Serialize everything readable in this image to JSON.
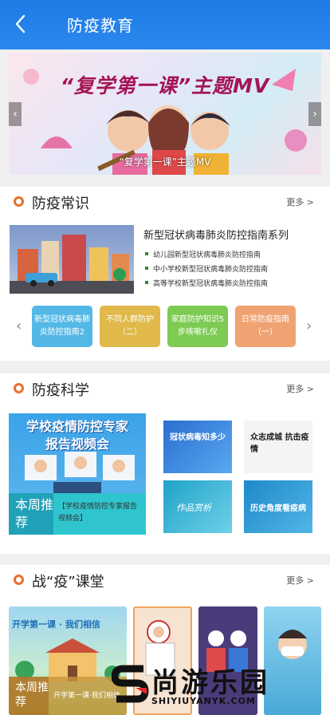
{
  "header": {
    "title": "防疫教育"
  },
  "banner": {
    "title": "“复学第一课”主题MV",
    "caption": "“复学第一课”主题MV"
  },
  "knowledge": {
    "title": "防疫常识",
    "more": "更多 >",
    "topic": "新型冠状病毒肺炎防控指南系列",
    "items": [
      "幼儿园新型冠状病毒肺炎防控指南",
      "中小学校新型冠状病毒肺炎防控指南",
      "高等学校新型冠状病毒肺炎防控指南"
    ],
    "cards": [
      {
        "label": "新型冠状病毒肺炎防控指南2",
        "color": "#53b8e6"
      },
      {
        "label": "不同人群防护（二）",
        "color": "#e0b94a"
      },
      {
        "label": "家庭防护知识5步咳嗽礼仪",
        "color": "#7dcb53"
      },
      {
        "label": "日常防疫指南（一）",
        "color": "#f0a372"
      }
    ]
  },
  "science": {
    "title": "防疫科学",
    "more": "更多 >",
    "feature_title": "学校疫情防控专家报告视频会",
    "weekly_label": "本周推荐",
    "weekly_text": "【学校疫情防控专家报告视频会】",
    "thumbs": [
      {
        "text": "冠状病毒知多少"
      },
      {
        "text": "众志成城 抗击疫情"
      },
      {
        "text": "作品赏析"
      },
      {
        "text": "历史角度看疫病"
      }
    ]
  },
  "classroom": {
    "title": "战“疫”课堂",
    "more": "更多 >",
    "thumb_title": "开学第一课 · 我们相信",
    "weekly_label": "本周推荐",
    "weekly_text": "开学第一课·我们相信"
  },
  "watermark": {
    "text": "尚游乐园",
    "sub": "SHIYIUYANYK.COM"
  }
}
